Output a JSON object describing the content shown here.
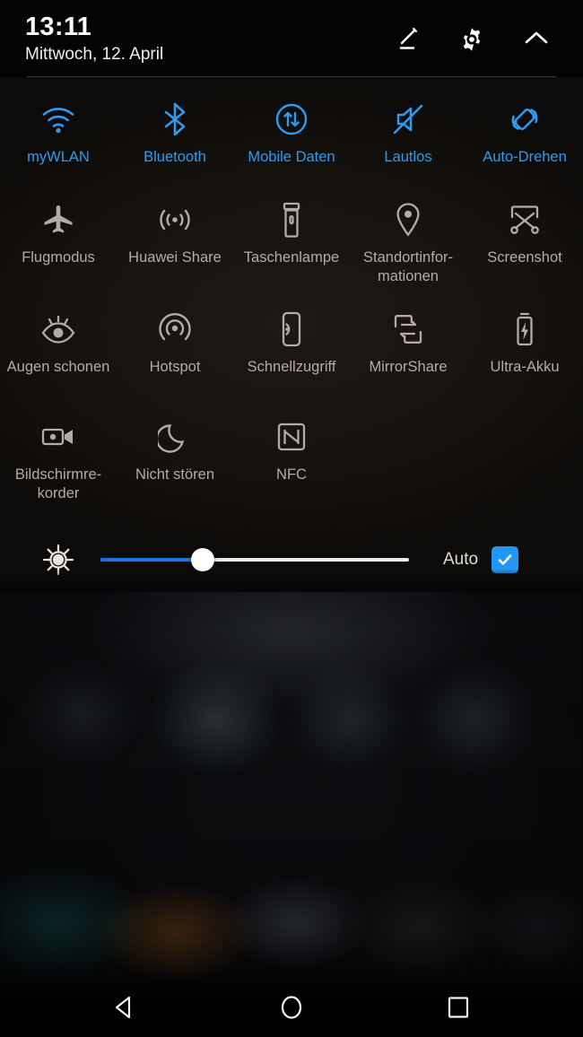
{
  "statusbar": {
    "time": "13:11",
    "date": "Mittwoch, 12. April"
  },
  "header": {
    "edit_icon": "pencil-edit-icon",
    "settings_icon": "gear-icon",
    "collapse_icon": "chevron-up-icon"
  },
  "colors": {
    "accent_blue": "#2e9bf0",
    "slider_blue": "#1a73e8",
    "checkbox_blue": "#2196f3",
    "inactive_gray": "#b3aca6",
    "panel_background": "#0b0908"
  },
  "tiles": [
    [
      {
        "label": "myWLAN",
        "icon": "wifi-icon",
        "active": true
      },
      {
        "label": "Bluetooth",
        "icon": "bluetooth-icon",
        "active": true
      },
      {
        "label": "Mobile Daten",
        "icon": "mobile-data-icon",
        "active": true
      },
      {
        "label": "Lautlos",
        "icon": "mute-icon",
        "active": true
      },
      {
        "label": "Auto-Drehen",
        "icon": "auto-rotate-icon",
        "active": true
      }
    ],
    [
      {
        "label": "Flugmodus",
        "icon": "airplane-icon",
        "active": false
      },
      {
        "label": "Huawei Share",
        "icon": "share-waves-icon",
        "active": false
      },
      {
        "label": "Taschenlampe",
        "icon": "flashlight-icon",
        "active": false
      },
      {
        "label": "Standortinfor-mationen",
        "icon": "location-pin-icon",
        "active": false
      },
      {
        "label": "Screenshot",
        "icon": "screenshot-icon",
        "active": false
      }
    ],
    [
      {
        "label": "Augen schonen",
        "icon": "eye-comfort-icon",
        "active": false
      },
      {
        "label": "Hotspot",
        "icon": "hotspot-icon",
        "active": false
      },
      {
        "label": "Schnellzugriff",
        "icon": "quick-access-icon",
        "active": false
      },
      {
        "label": "MirrorShare",
        "icon": "mirror-share-icon",
        "active": false
      },
      {
        "label": "Ultra-Akku",
        "icon": "battery-saver-icon",
        "active": false
      }
    ],
    [
      {
        "label": "Bildschirmre-korder",
        "icon": "screen-recorder-icon",
        "active": false
      },
      {
        "label": "Nicht stören",
        "icon": "moon-icon",
        "active": false
      },
      {
        "label": "NFC",
        "icon": "nfc-icon",
        "active": false
      }
    ]
  ],
  "brightness": {
    "icon": "brightness-sun-icon",
    "value_percent": 33,
    "auto_label": "Auto",
    "auto_checked": true
  },
  "navbar": {
    "back": "back-triangle-icon",
    "home": "home-circle-icon",
    "recents": "recents-square-icon"
  }
}
